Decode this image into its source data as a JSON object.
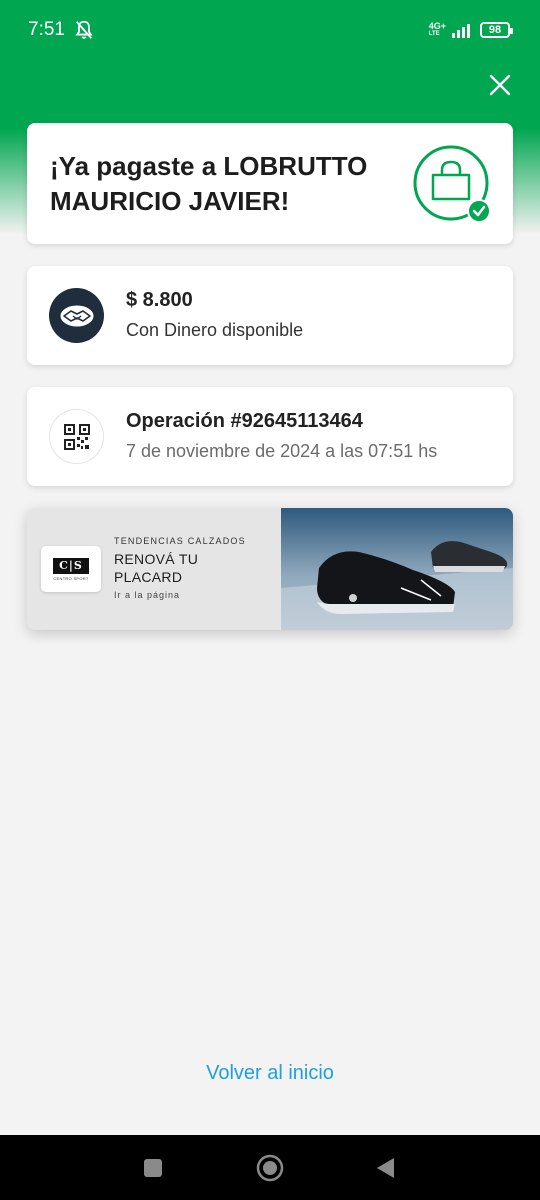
{
  "status_bar": {
    "time": "7:51",
    "network": "4G+",
    "network_sub": "LTE",
    "battery": "98"
  },
  "success_card": {
    "title": "¡Ya pagaste a LOBRUTTO MAURICIO JAVIER!",
    "icon": "shopping-bag-check-icon"
  },
  "payment_card": {
    "amount": "$ 8.800",
    "method": "Con Dinero disponible",
    "icon": "handshake-icon"
  },
  "operation_card": {
    "title": "Operación #92645113464",
    "date": "7 de noviembre de 2024 a las 07:51 hs",
    "icon": "qr-code-icon"
  },
  "ad_banner": {
    "logo_text": "C|S",
    "logo_subtext": "CENTRO SPORT",
    "kicker": "TENDENCIAS CALZADOS",
    "title": "RENOVÁ TU PLACARD",
    "link": "Ir a la página"
  },
  "footer": {
    "back_link": "Volver al inicio"
  },
  "colors": {
    "brand_green": "#00a650",
    "link_blue": "#1d9fe0"
  }
}
